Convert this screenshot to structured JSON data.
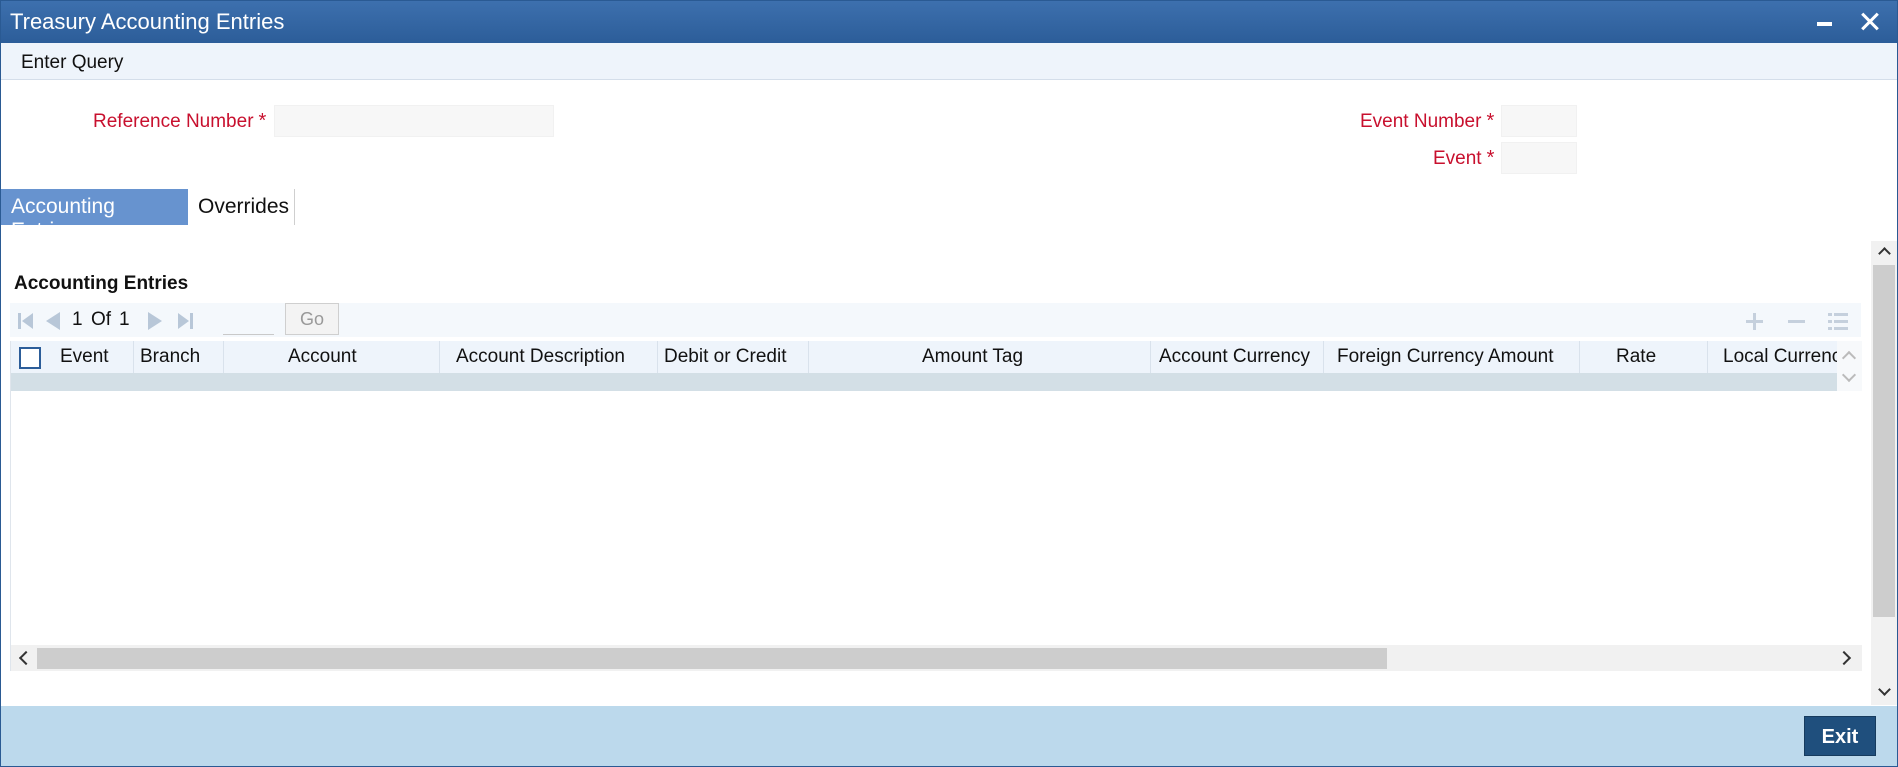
{
  "window": {
    "title": "Treasury Accounting Entries"
  },
  "menu": {
    "enter_query": "Enter Query"
  },
  "fields": {
    "reference_number": {
      "label": "Reference Number",
      "required": "*",
      "value": ""
    },
    "event_number": {
      "label": "Event Number",
      "required": "*",
      "value": ""
    },
    "event": {
      "label": "Event",
      "required": "*",
      "value": ""
    }
  },
  "tabs": [
    {
      "label": "Accounting Entries",
      "active": true
    },
    {
      "label": "Overrides",
      "active": false
    }
  ],
  "section": {
    "title": "Accounting Entries"
  },
  "pagination": {
    "current": "1",
    "of": "Of",
    "total": "1",
    "go": "Go",
    "page_input": ""
  },
  "table": {
    "columns": [
      "Event",
      "Branch",
      "Account",
      "Account Description",
      "Debit or Credit",
      "Amount Tag",
      "Account Currency",
      "Foreign Currency Amount",
      "Rate",
      "Local Currenc"
    ],
    "rows": []
  },
  "footer": {
    "exit_label": "Exit"
  },
  "colors": {
    "titlebar": "#2c5d99",
    "active_tab": "#6793cf",
    "required_label": "#c8102e",
    "footer": "#bcd9ec",
    "exit_button": "#1f4f7d"
  }
}
